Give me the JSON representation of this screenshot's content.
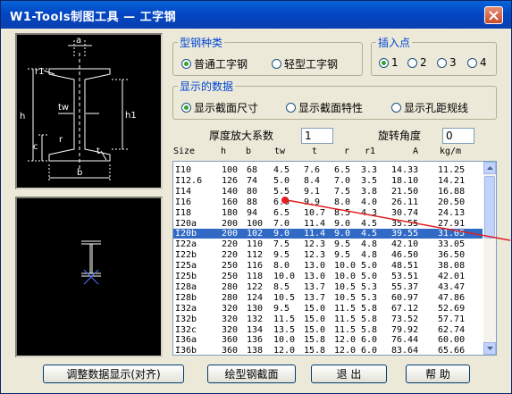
{
  "window": {
    "title": "W1-Tools制图工具 — 工字钢"
  },
  "steel_type": {
    "label": "型钢种类",
    "options": [
      {
        "label": "普通工字钢",
        "selected": true
      },
      {
        "label": "轻型工字钢",
        "selected": false
      }
    ]
  },
  "insert_point": {
    "label": "插入点",
    "options": [
      {
        "label": "1",
        "selected": true
      },
      {
        "label": "2",
        "selected": false
      },
      {
        "label": "3",
        "selected": false
      },
      {
        "label": "4",
        "selected": false
      }
    ]
  },
  "display_data": {
    "label": "显示的数据",
    "options": [
      {
        "label": "显示截面尺寸",
        "selected": true
      },
      {
        "label": "显示截面特性",
        "selected": false
      },
      {
        "label": "显示孔距规线",
        "selected": false
      }
    ]
  },
  "thickness_factor": {
    "label": "厚度放大系数",
    "value": "1"
  },
  "rotation": {
    "label": "旋转角度",
    "value": "0"
  },
  "diagram_labels": {
    "a": "a",
    "r1": "r1",
    "h": "h",
    "tw": "tw",
    "h1": "h1",
    "c": "c",
    "r": "r",
    "t": "t",
    "b": "b"
  },
  "table": {
    "columns": [
      "Size",
      "h",
      "b",
      "tw",
      "t",
      "r",
      "r1",
      "A",
      "kg/m"
    ],
    "rows": [
      [
        "I10",
        "100",
        "68",
        "4.5",
        "7.6",
        "6.5",
        "3.3",
        "14.33",
        "11.25"
      ],
      [
        "I12.6",
        "126",
        "74",
        "5.0",
        "8.4",
        "7.0",
        "3.5",
        "18.10",
        "14.21"
      ],
      [
        "I14",
        "140",
        "80",
        "5.5",
        "9.1",
        "7.5",
        "3.8",
        "21.50",
        "16.88"
      ],
      [
        "I16",
        "160",
        "88",
        "6.0",
        "9.9",
        "8.0",
        "4.0",
        "26.11",
        "20.50"
      ],
      [
        "I18",
        "180",
        "94",
        "6.5",
        "10.7",
        "8.5",
        "4.3",
        "30.74",
        "24.13"
      ],
      [
        "I20a",
        "200",
        "100",
        "7.0",
        "11.4",
        "9.0",
        "4.5",
        "35.55",
        "27.91"
      ],
      [
        "I20b",
        "200",
        "102",
        "9.0",
        "11.4",
        "9.0",
        "4.5",
        "39.55",
        "31.05"
      ],
      [
        "I22a",
        "220",
        "110",
        "7.5",
        "12.3",
        "9.5",
        "4.8",
        "42.10",
        "33.05"
      ],
      [
        "I22b",
        "220",
        "112",
        "9.5",
        "12.3",
        "9.5",
        "4.8",
        "46.50",
        "36.50"
      ],
      [
        "I25a",
        "250",
        "116",
        "8.0",
        "13.0",
        "10.0",
        "5.0",
        "48.51",
        "38.08"
      ],
      [
        "I25b",
        "250",
        "118",
        "10.0",
        "13.0",
        "10.0",
        "5.0",
        "53.51",
        "42.01"
      ],
      [
        "I28a",
        "280",
        "122",
        "8.5",
        "13.7",
        "10.5",
        "5.3",
        "55.37",
        "43.47"
      ],
      [
        "I28b",
        "280",
        "124",
        "10.5",
        "13.7",
        "10.5",
        "5.3",
        "60.97",
        "47.86"
      ],
      [
        "I32a",
        "320",
        "130",
        "9.5",
        "15.0",
        "11.5",
        "5.8",
        "67.12",
        "52.69"
      ],
      [
        "I32b",
        "320",
        "132",
        "11.5",
        "15.0",
        "11.5",
        "5.8",
        "73.52",
        "57.71"
      ],
      [
        "I32c",
        "320",
        "134",
        "13.5",
        "15.0",
        "11.5",
        "5.8",
        "79.92",
        "62.74"
      ],
      [
        "I36a",
        "360",
        "136",
        "10.0",
        "15.8",
        "12.0",
        "6.0",
        "76.44",
        "60.00"
      ],
      [
        "I36b",
        "360",
        "138",
        "12.0",
        "15.8",
        "12.0",
        "6.0",
        "83.64",
        "65.66"
      ]
    ],
    "selected_index": 6
  },
  "buttons": {
    "adjust": "调整数据显示(对齐)",
    "draw": "绘型钢截面",
    "exit": "退 出",
    "help": "帮 助"
  },
  "colors": {
    "selection": "#316ac5",
    "group_label": "#0046d5",
    "diagram_line": "#ffffff"
  }
}
